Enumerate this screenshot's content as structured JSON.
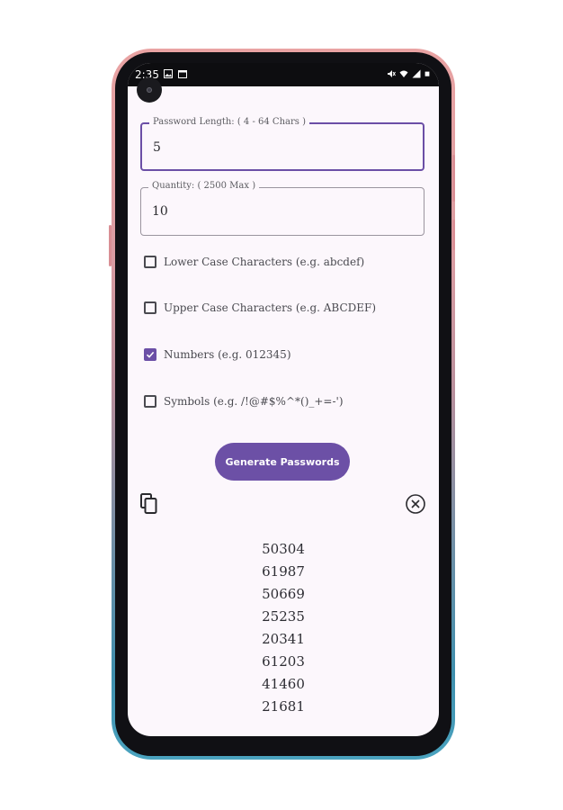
{
  "status_bar": {
    "time": "2:35",
    "left_icons": [
      "image-icon",
      "calendar-icon"
    ],
    "right_icons": [
      "mute-icon",
      "wifi-icon",
      "signal-icon",
      "battery-icon"
    ]
  },
  "form": {
    "length": {
      "label": "Password Length: ( 4 - 64 Chars )",
      "value": "5"
    },
    "quantity": {
      "label": "Quantity: ( 2500 Max )",
      "value": "10"
    }
  },
  "options": [
    {
      "label": "Lower Case Characters (e.g. abcdef)",
      "checked": false
    },
    {
      "label": "Upper Case Characters (e.g. ABCDEF)",
      "checked": false
    },
    {
      "label": "Numbers (e.g. 012345)",
      "checked": true
    },
    {
      "label": "Symbols (e.g. /!@#$%^*()_+=-')",
      "checked": false
    }
  ],
  "generate_button": {
    "label": "Generate Passwords"
  },
  "actions": {
    "copy_icon": "copy-icon",
    "clear_icon": "close-circle-icon"
  },
  "passwords": [
    "50304",
    "61987",
    "50669",
    "25235",
    "20341",
    "61203",
    "41460",
    "21681"
  ],
  "colors": {
    "accent": "#6c50a6",
    "screen_bg": "#fcf7fc"
  }
}
